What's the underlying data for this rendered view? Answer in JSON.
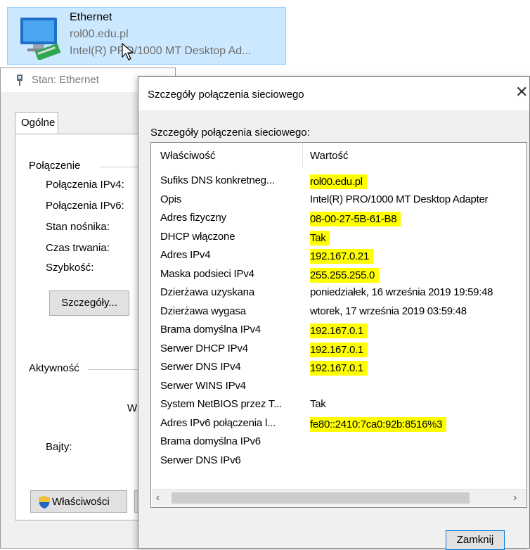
{
  "adapter": {
    "name": "Ethernet",
    "domain": "rol00.edu.pl",
    "description": "Intel(R) PRO/1000 MT Desktop Ad..."
  },
  "status_window": {
    "title": "Stan: Ethernet",
    "tab": "Ogólne",
    "connection_group": "Połączenie",
    "fields": [
      "Połączenia IPv4:",
      "Połączenia IPv6:",
      "Stan nośnika:",
      "Czas trwania:",
      "Szybkość:"
    ],
    "details_button": "Szczegóły...",
    "activity_group": "Aktywność",
    "clipped_text": "W",
    "bytes_label": "Bajty:",
    "properties_button": "Właściwości"
  },
  "dialog": {
    "title": "Szczegóły połączenia sieciowego",
    "caption": "Szczegóły połączenia sieciowego:",
    "col_property": "Właściwość",
    "col_value": "Wartość",
    "close_button": "Zamknij",
    "rows": [
      {
        "prop": "Sufiks DNS konkretneg...",
        "value": "rol00.edu.pl",
        "highlight": true
      },
      {
        "prop": "Opis",
        "value": "Intel(R) PRO/1000 MT Desktop Adapter",
        "highlight": false
      },
      {
        "prop": "Adres fizyczny",
        "value": "08-00-27-5B-61-B8",
        "highlight": true
      },
      {
        "prop": "DHCP włączone",
        "value": "Tak",
        "highlight": true
      },
      {
        "prop": "Adres IPv4",
        "value": "192.167.0.21",
        "highlight": true
      },
      {
        "prop": "Maska podsieci IPv4",
        "value": "255.255.255.0",
        "highlight": true
      },
      {
        "prop": "Dzierżawa uzyskana",
        "value": "poniedziałek, 16 września 2019 19:59:48",
        "highlight": false
      },
      {
        "prop": "Dzierżawa wygasa",
        "value": "wtorek, 17 września 2019 03:59:48",
        "highlight": false
      },
      {
        "prop": "Brama domyślna IPv4",
        "value": "192.167.0.1",
        "highlight": true
      },
      {
        "prop": "Serwer DHCP IPv4",
        "value": "192.167.0.1",
        "highlight": true
      },
      {
        "prop": "Serwer DNS IPv4",
        "value": "192.167.0.1",
        "highlight": true
      },
      {
        "prop": "Serwer WINS IPv4",
        "value": "",
        "highlight": false
      },
      {
        "prop": "System NetBIOS przez T...",
        "value": "Tak",
        "highlight": false
      },
      {
        "prop": "Adres IPv6 połączenia l...",
        "value": "fe80::2410:7ca0:92b:8516%3",
        "highlight": true
      },
      {
        "prop": "Brama domyślna IPv6",
        "value": "",
        "highlight": false
      },
      {
        "prop": "Serwer DNS IPv6",
        "value": "",
        "highlight": false
      }
    ]
  },
  "icons": {
    "adapter": "network-adapter-icon",
    "status": "ethernet-plug-icon",
    "shield": "uac-shield-icon",
    "close": "close-icon",
    "scroll_left": "scroll-left-icon",
    "scroll_right": "scroll-right-icon"
  },
  "colors": {
    "highlight": "#ffff00",
    "selection": "#cce8ff",
    "accent": "#0078d7"
  }
}
